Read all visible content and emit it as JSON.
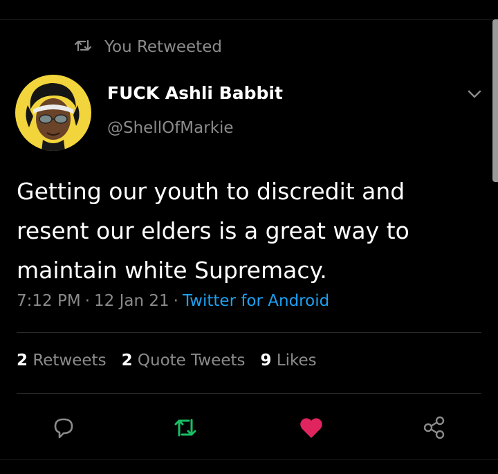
{
  "retweet_banner": {
    "icon": "retweet-icon",
    "text": "You Retweeted"
  },
  "author": {
    "name": "FUCK Ashli Babbit",
    "handle": "@ShellOfMarkie",
    "avatar_color": "#f2d53c"
  },
  "tweet": {
    "text": "Getting our youth to discredit and resent our elders is a great way to maintain white Supremacy.",
    "time": "7:12 PM",
    "date": "12 Jan 21",
    "source": "Twitter for Android"
  },
  "stats": {
    "retweets_count": "2",
    "retweets_label": "Retweets",
    "quotes_count": "2",
    "quotes_label": "Quote Tweets",
    "likes_count": "9",
    "likes_label": "Likes"
  },
  "actions": {
    "reply_icon": "reply-icon",
    "retweet_icon": "retweet-icon",
    "like_icon": "heart-icon",
    "share_icon": "share-icon",
    "retweet_active_color": "#17bf63",
    "like_active_color": "#e0245e"
  },
  "colors": {
    "background": "#000000",
    "secondary_text": "#8b8b8b",
    "link": "#1da1f2"
  }
}
